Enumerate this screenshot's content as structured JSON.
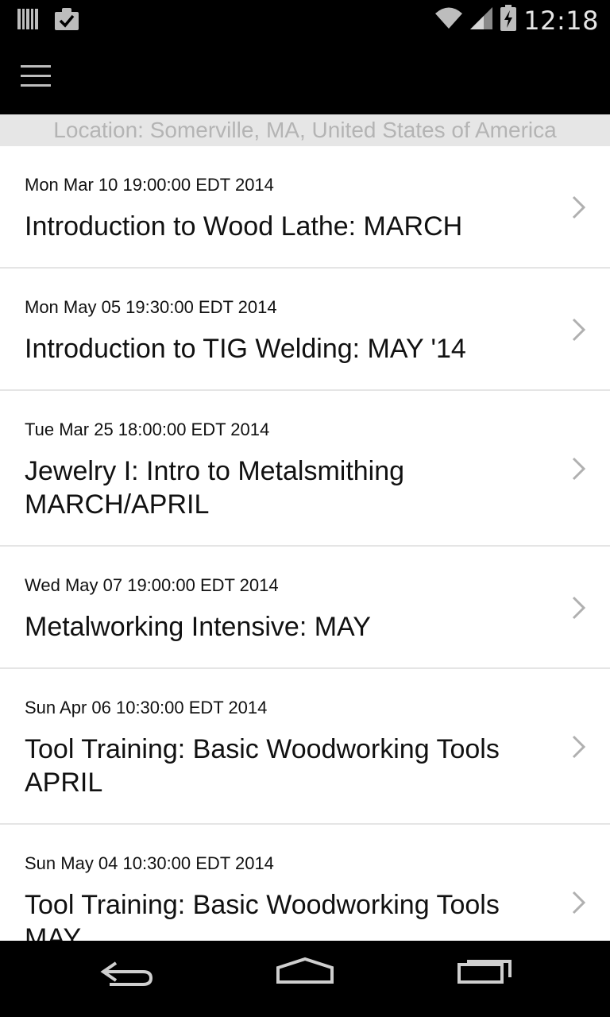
{
  "status_bar": {
    "time": "12:18",
    "left_icons": [
      "barcode-icon",
      "clipboard-check-icon"
    ],
    "right_icons": [
      "wifi-icon",
      "signal-icon",
      "battery-charging-icon"
    ]
  },
  "action_bar": {
    "menu_icon": "hamburger-menu-icon"
  },
  "location": {
    "text": "Location: Somerville, MA, United States of America"
  },
  "events": [
    {
      "date": "Mon Mar 10 19:00:00 EDT 2014",
      "title": "Introduction to Wood Lathe: MARCH"
    },
    {
      "date": "Mon May 05 19:30:00 EDT 2014",
      "title": "Introduction to TIG Welding: MAY '14"
    },
    {
      "date": "Tue Mar 25 18:00:00 EDT 2014",
      "title": "Jewelry I: Intro to Metalsmithing MARCH/APRIL"
    },
    {
      "date": "Wed May 07 19:00:00 EDT 2014",
      "title": "Metalworking Intensive: MAY"
    },
    {
      "date": "Sun Apr 06 10:30:00 EDT 2014",
      "title": "Tool Training: Basic Woodworking Tools APRIL"
    },
    {
      "date": "Sun May 04 10:30:00 EDT 2014",
      "title": "Tool Training: Basic Woodworking Tools MAY"
    }
  ],
  "nav_bar": {
    "icons": [
      "back-icon",
      "home-icon",
      "recent-apps-icon"
    ]
  },
  "colors": {
    "bar_background": "#000000",
    "location_background": "#e6e6e6",
    "location_text": "#b4b4b4",
    "divider": "#e5e5e5",
    "chevron": "#b0b0b0"
  }
}
